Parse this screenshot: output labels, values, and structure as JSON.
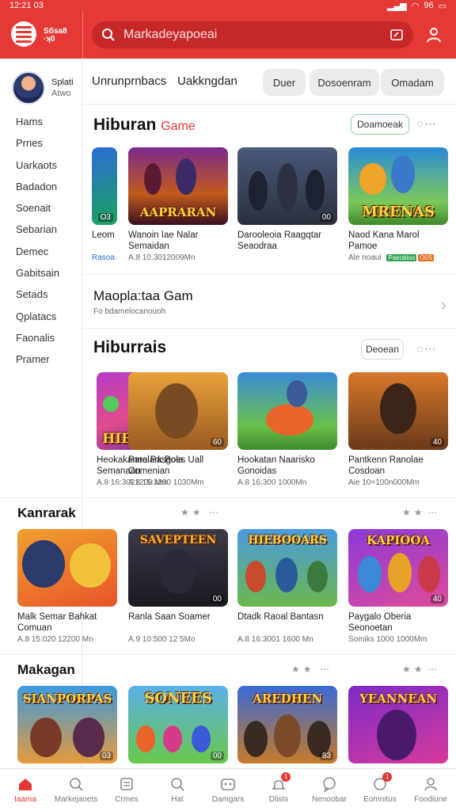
{
  "status": {
    "time": "12:21 03",
    "battery": "96"
  },
  "header": {
    "brand": "Sбsa8 ·ʞ0",
    "search_placeholder": "Markadeyapoeai"
  },
  "colors": {
    "accent": "#e53935",
    "accent_dark": "#c62828"
  },
  "sidebar": {
    "profile_name": "Splati",
    "profile_sub": "Atwo",
    "items": [
      "Hams",
      "Prnes",
      "Uarkaots",
      "Badadon",
      "Soenait",
      "Sebarian",
      "Demec",
      "Gabitsain",
      "Setads",
      "Qplatacs",
      "Faonalis",
      "Pramer"
    ]
  },
  "tabs": {
    "tab1": "Unrunprnbacs",
    "tab2": "Uakkngdan",
    "chip1": "Duer",
    "chip2": "Dosoenram",
    "chip3": "Omadam"
  },
  "section1": {
    "title": "Hiburan",
    "accent": "Game",
    "button": "Doamoeak",
    "cards": [
      {
        "title": "Leom",
        "meta": "Rasoa",
        "art": "",
        "badge": "O3"
      },
      {
        "title": "Wanoin Iae Nalar Semaidan",
        "meta": "A.8 10.3012009Mn",
        "art": "AAPRARAN",
        "badge": ""
      },
      {
        "title": "Darooleoia Raagqtar Seaodraa",
        "meta": "",
        "art": "",
        "badge": "00"
      },
      {
        "title": "Naod Kana Marol Pamoe",
        "meta": "Ale noaui",
        "art": "MRENAS",
        "badge": "",
        "tag1": "Paeobioo",
        "tag2": "O0S"
      }
    ]
  },
  "promo": {
    "title": "Maopla:taa Gam",
    "subtitle": "Fo bdamelocanouoh"
  },
  "section2": {
    "title": "Hiburrais",
    "button": "Deoean",
    "cards": [
      {
        "title": "Heokakanna Pasgola Semanaan",
        "meta": "A.8 16:3021200 Mm",
        "art": "HIBLAAKIS",
        "badge": ""
      },
      {
        "title": "Parolark Boes Uall Comenian",
        "meta": "A.8 15:3200 1030Mm",
        "art": "",
        "badge": "60"
      },
      {
        "title": "Hookatan Naarisko Gonoidas",
        "meta": "A.8 16:300 1000Mn",
        "art": "",
        "badge": ""
      },
      {
        "title": "Pantkenn Ranolae Cosdoan",
        "meta": "Aie 10=100n000Mm",
        "art": "",
        "badge": "40"
      }
    ]
  },
  "section3": {
    "title": "Kanrarak",
    "cards": [
      {
        "title": "Malk Semar Bahkat Comuan",
        "meta": "A.8 15:020 12200 Mn",
        "art": "",
        "badge": ""
      },
      {
        "title": "Ranla Saan Soamer",
        "meta": "A.9 10:500 12 5Mo",
        "art": "SAVEPTEEN",
        "badge": "00"
      },
      {
        "title": "Dtadk Raoal Bantasn",
        "meta": "A.8 16:3001 1600 Mn",
        "art": "HIEBOOARS",
        "badge": ""
      },
      {
        "title": "Paygalo Oberia Seonoetan",
        "meta": "Somiks 1000 1000Mm",
        "art": "KAPIOOA",
        "badge": "40"
      }
    ]
  },
  "section4": {
    "title": "Makagan",
    "cards": [
      {
        "art": "SIANPORPAS",
        "badge": "03"
      },
      {
        "art": "SONEES",
        "badge": "00"
      },
      {
        "art": "AREDHEN",
        "badge": "83"
      },
      {
        "art": "YEANNEAN",
        "badge": ""
      }
    ]
  },
  "bottom_nav": [
    {
      "label": "Iaama",
      "icon": "home-icon",
      "active": true
    },
    {
      "label": "Markejaoets",
      "icon": "search-icon"
    },
    {
      "label": "Crmes",
      "icon": "list-icon"
    },
    {
      "label": "Hat",
      "icon": "search-icon"
    },
    {
      "label": "Damgars",
      "icon": "gamepad-icon"
    },
    {
      "label": "Dlists",
      "icon": "bell-icon",
      "badge": "1"
    },
    {
      "label": "Nenoobar",
      "icon": "chat-icon"
    },
    {
      "label": "Eomnitus",
      "icon": "message-icon",
      "badge": "1"
    },
    {
      "label": "Foodiune",
      "icon": "person-icon"
    }
  ]
}
